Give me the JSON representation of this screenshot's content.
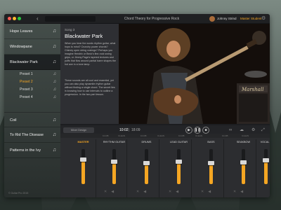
{
  "window": {
    "title": "Chord Theory for Progressive Rock",
    "user_name": "Johnny Strind",
    "user_role": "Master Student",
    "traffic_colors": [
      "#ff5f56",
      "#ffbd2e",
      "#27c93f"
    ]
  },
  "sidebar": {
    "items": [
      {
        "label": "Hope Leaves",
        "icon": "music-note-icon"
      },
      {
        "label": "Windowpane",
        "icon": "music-note-icon"
      },
      {
        "label": "Blackwater Park",
        "icon": "music-note-icon",
        "active": true
      },
      {
        "label": "Coil",
        "icon": "music-note-icon"
      },
      {
        "label": "To Rid The Disease",
        "icon": "music-note-icon"
      },
      {
        "label": "Patterns in the Ivy",
        "icon": "music-note-icon"
      }
    ],
    "presets": [
      {
        "label": "Preset 1"
      },
      {
        "label": "Preset 2",
        "selected": true
      },
      {
        "label": "Preset 3"
      },
      {
        "label": "Preset 4"
      }
    ],
    "copyright": "© Guitar Pro 2015"
  },
  "lyrics": {
    "song_number": "Song 3",
    "song_title": "Blackwater Park",
    "paragraph1": "When you hear the words rhythm guitar, what hops to mind? Crunchy power chords? Chimey open string voicings? Perhaps you imagine Hendrix or Beck's fine-rock swing grips, or Jimmy Page's layered textures and puffs that flow around partial barre shapes the hot axe in a tone lamp.",
    "paragraph2": "These sounds are all cool and essential, yet you can also play dynamite rhythm guitar without finding a single chord. The secret lies in knowing how to use intervals to outline a progression. In the two-part lesson."
  },
  "transport": {
    "mixer_label": "Mixer Design",
    "current_time": "10:02",
    "total_time": "18:09",
    "progress": 0.55
  },
  "mixer": {
    "header_labels": [
      "10-DB",
      "CLEAN",
      "10-DB",
      "CLEAN",
      "10-DB",
      "CLEAN",
      "10-DB",
      "CLEAN"
    ],
    "channels": [
      {
        "name": "MASTER",
        "level": 0.7
      },
      {
        "name": "RHYTHM GUITAR",
        "level": 0.65
      },
      {
        "name": "DRUMS",
        "level": 0.6
      },
      {
        "name": "LEAD GUITAR",
        "level": 0.65
      },
      {
        "name": "BASS",
        "level": 0.6
      },
      {
        "name": "SEAKBOW",
        "level": 0.62
      },
      {
        "name": "VOCAL",
        "level": 0.68
      }
    ]
  },
  "colors": {
    "accent": "#f5a623"
  }
}
